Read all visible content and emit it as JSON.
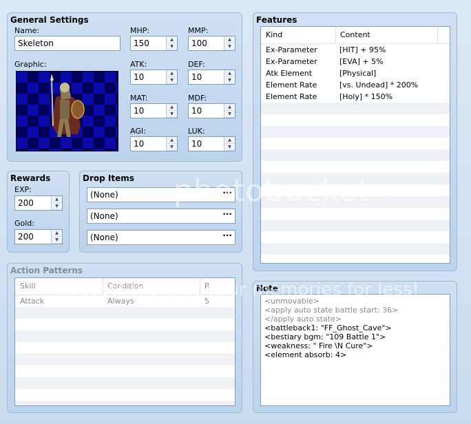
{
  "general": {
    "title": "General Settings",
    "name_label": "Name:",
    "name_value": "Skeleton",
    "graphic_label": "Graphic:",
    "stats": [
      {
        "label": "MHP:",
        "value": "150"
      },
      {
        "label": "MMP:",
        "value": "100"
      },
      {
        "label": "ATK:",
        "value": "10"
      },
      {
        "label": "DEF:",
        "value": "10"
      },
      {
        "label": "MAT:",
        "value": "10"
      },
      {
        "label": "MDF:",
        "value": "10"
      },
      {
        "label": "AGI:",
        "value": "10"
      },
      {
        "label": "LUK:",
        "value": "10"
      }
    ]
  },
  "rewards": {
    "title": "Rewards",
    "exp_label": "EXP:",
    "exp_value": "200",
    "gold_label": "Gold:",
    "gold_value": "200"
  },
  "drops": {
    "title": "Drop Items",
    "items": [
      "(None)",
      "(None)",
      "(None)"
    ],
    "button": "···"
  },
  "features": {
    "title": "Features",
    "headers": [
      "Kind",
      "Content"
    ],
    "rows": [
      {
        "kind": "Ex-Parameter",
        "content": "[HIT] + 95%"
      },
      {
        "kind": "Ex-Parameter",
        "content": "[EVA] + 5%"
      },
      {
        "kind": "Atk Element",
        "content": "[Physical]"
      },
      {
        "kind": "Element Rate",
        "content": "[vs. Undead] * 200%"
      },
      {
        "kind": "Element Rate",
        "content": "[Holy] * 150%"
      }
    ]
  },
  "actions": {
    "title": "Action Patterns",
    "headers": [
      "Skill",
      "Condition",
      "R"
    ],
    "rows": [
      {
        "skill": "Attack",
        "condition": "Always",
        "r": "5"
      }
    ]
  },
  "note": {
    "title": "Note",
    "lines": [
      {
        "text": "<unmovable>",
        "grey": true
      },
      {
        "text": "<apply auto state battle start: 36>",
        "grey": true
      },
      {
        "text": "</apply auto state>",
        "grey": true
      },
      {
        "text": "<battleback1: \"FF_Ghost_Cave\">",
        "grey": false
      },
      {
        "text": "<bestiary bgm: \"109 Battle 1\">",
        "grey": false
      },
      {
        "text": "<weakness: \" Fire \\N Cure\">",
        "grey": false
      },
      {
        "text": "<element absorb: 4>",
        "grey": false
      }
    ]
  },
  "watermark": {
    "brand": "photobucket",
    "tagline": "Protect more of your memories for less!"
  }
}
